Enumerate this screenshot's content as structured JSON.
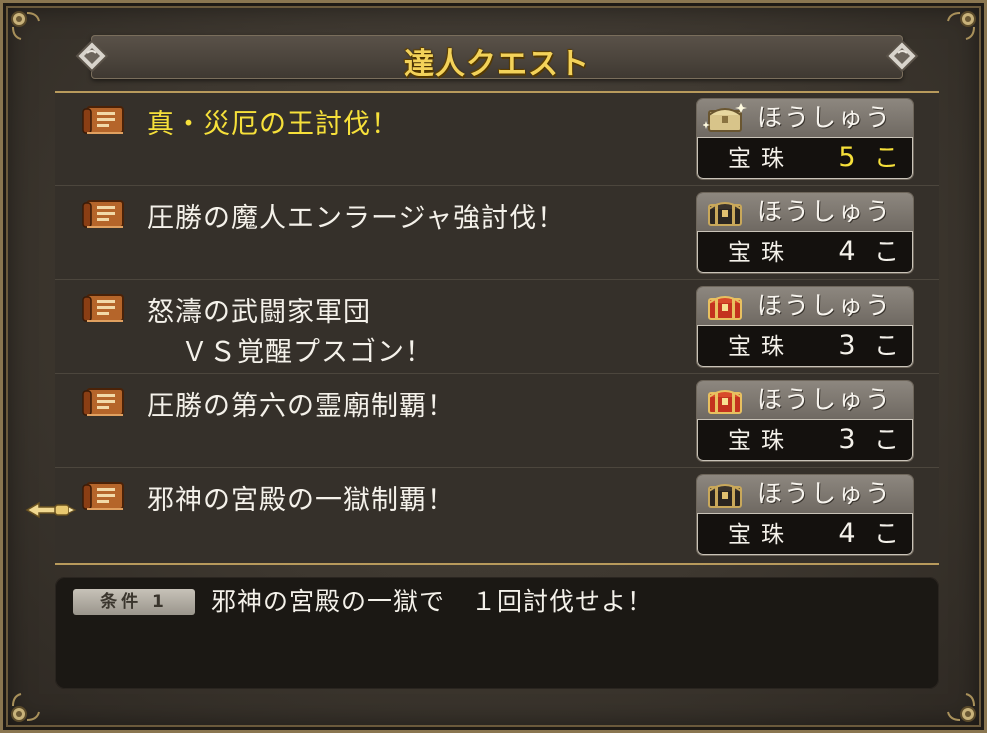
{
  "window": {
    "title": "達人クエスト"
  },
  "quests": [
    {
      "name": "真・災厄の王討伐！",
      "name2": "",
      "reward_label": "ほうしゅう",
      "item": "宝珠",
      "count": "5",
      "unit": "こ",
      "chest": "sparkle"
    },
    {
      "name": "圧勝の魔人エンラージャ強討伐！",
      "name2": "",
      "reward_label": "ほうしゅう",
      "item": "宝珠",
      "count": "4",
      "unit": "こ",
      "chest": "black"
    },
    {
      "name": "怒濤の武闘家軍団",
      "name2": "ＶＳ覚醒プスゴン！",
      "reward_label": "ほうしゅう",
      "item": "宝珠",
      "count": "3",
      "unit": "こ",
      "chest": "red"
    },
    {
      "name": "圧勝の第六の霊廟制覇！",
      "name2": "",
      "reward_label": "ほうしゅう",
      "item": "宝珠",
      "count": "3",
      "unit": "こ",
      "chest": "red"
    },
    {
      "name": "邪神の宮殿の一獄制覇！",
      "name2": "",
      "reward_label": "ほうしゅう",
      "item": "宝珠",
      "count": "4",
      "unit": "こ",
      "chest": "black"
    }
  ],
  "condition": {
    "tag": "条件 1",
    "text": "邪神の宮殿の一獄で　１回討伐せよ！"
  },
  "colors": {
    "highlight": "#f6e03a",
    "text": "#f4f1ea",
    "gold_frame": "#b89a5c"
  },
  "icons": {
    "quest": "scroll-icon",
    "cursor": "pointing-hand-icon"
  }
}
